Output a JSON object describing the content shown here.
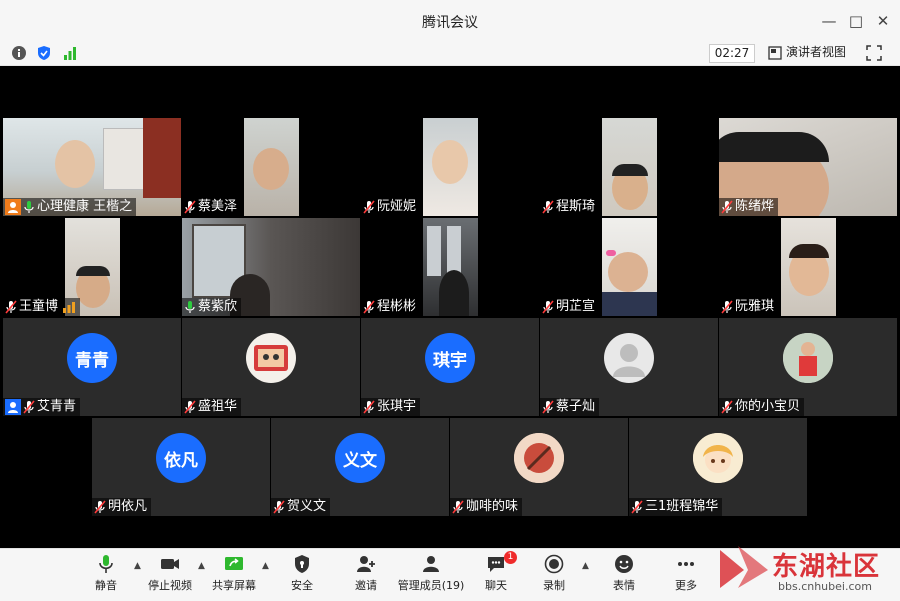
{
  "window": {
    "title": "腾讯会议"
  },
  "infobar": {
    "timer": "02:27",
    "speaker_view": "演讲者视图"
  },
  "participants": [
    {
      "name": "心理健康 王楷之",
      "mic": "on",
      "host": true
    },
    {
      "name": "蔡美泽",
      "mic": "muted"
    },
    {
      "name": "阮娅妮",
      "mic": "muted"
    },
    {
      "name": "程斯琦",
      "mic": "muted"
    },
    {
      "name": "陈绪烨",
      "mic": "muted"
    },
    {
      "name": "王童博",
      "mic": "muted"
    },
    {
      "name": "蔡紫欣",
      "mic": "on"
    },
    {
      "name": "程彬彬",
      "mic": "muted"
    },
    {
      "name": "明芷宣",
      "mic": "muted"
    },
    {
      "name": "阮雅琪",
      "mic": "muted"
    },
    {
      "name": "艾青青",
      "mic": "muted",
      "avatar_text": "青青",
      "cohost": true
    },
    {
      "name": "盛祖华",
      "mic": "muted"
    },
    {
      "name": "张琪宇",
      "mic": "muted",
      "avatar_text": "琪宇"
    },
    {
      "name": "蔡子灿",
      "mic": "muted"
    },
    {
      "name": "你的小宝贝",
      "mic": "muted"
    },
    {
      "name": "明依凡",
      "mic": "muted",
      "avatar_text": "依凡"
    },
    {
      "name": "贺义文",
      "mic": "muted",
      "avatar_text": "义文"
    },
    {
      "name": "咖啡的味",
      "mic": "muted"
    },
    {
      "name": "三1班程锦华",
      "mic": "muted"
    }
  ],
  "toolbar": {
    "mute": "静音",
    "stop_video": "停止视频",
    "share_screen": "共享屏幕",
    "security": "安全",
    "invite": "邀请",
    "manage_members": "管理成员(19)",
    "chat": "聊天",
    "chat_badge": "1",
    "record": "录制",
    "reactions": "表情",
    "more": "更多"
  },
  "watermark": {
    "brand": "东湖社区",
    "url": "bbs.cnhubei.com"
  },
  "colors": {
    "accent": "#1a6dff",
    "badge": "#ef2b2b",
    "watermark": "#d9343a"
  }
}
